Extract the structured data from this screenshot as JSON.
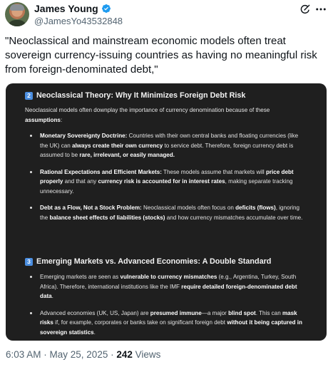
{
  "author": {
    "display_name": "James Young",
    "handle": "@JamesYo43532848"
  },
  "tweet_text": "\"Neoclassical and mainstream economic models often treat sovereign currency-issuing countries as having no meaningful risk from foreign-denominated debt,\"",
  "card": {
    "section1": {
      "number": "2",
      "title": "Neoclassical Theory: Why It Minimizes Foreign Debt Risk",
      "lead_a": "Neoclassical models often downplay the importance of currency denomination because of these ",
      "lead_b": "assumptions",
      "lead_c": ":",
      "items": [
        {
          "bold_1": "Monetary Sovereignty Doctrine:",
          "text_1": " Countries with their own central banks and floating currencies (like the UK) can ",
          "bold_2": "always create their own currency",
          "text_2": " to service debt. Therefore, foreign currency debt is assumed to be ",
          "bold_3": "rare, irrelevant, or easily managed.",
          "text_3": ""
        },
        {
          "bold_1": "Rational Expectations and Efficient Markets:",
          "text_1": " These models assume that markets will ",
          "bold_2": "price debt properly",
          "text_2": " and that any ",
          "bold_3": "currency risk is accounted for in interest rates",
          "text_3": ", making separate tracking unnecessary."
        },
        {
          "bold_1": "Debt as a Flow, Not a Stock Problem:",
          "text_1": " Neoclassical models often focus on ",
          "bold_2": "deficits (flows)",
          "text_2": ", ignoring the ",
          "bold_3": "balance sheet effects of liabilities (stocks)",
          "text_3": " and how currency mismatches accumulate over time."
        }
      ]
    },
    "section2": {
      "number": "3",
      "title": "Emerging Markets vs. Advanced Economies: A Double Standard",
      "items": [
        {
          "text_1": "Emerging markets are seen as ",
          "bold_1": "vulnerable to currency mismatches",
          "text_2": " (e.g., Argentina, Turkey, South Africa). Therefore, international institutions like the IMF ",
          "bold_2": "require detailed foreign-denominated debt data",
          "text_3": ".",
          "bold_3": "",
          "text_4": "",
          "bold_4": "",
          "text_5": ""
        },
        {
          "text_1": "Advanced economies (UK, US, Japan) are ",
          "bold_1": "presumed immune",
          "text_2": "—a major ",
          "bold_2": "blind spot",
          "text_3": ". This can ",
          "bold_3": "mask risks",
          "text_4": " if, for example, corporates or banks take on significant foreign debt ",
          "bold_4": "without it being captured in sovereign statistics",
          "text_5": "."
        }
      ]
    }
  },
  "meta": {
    "time": "6:03 AM",
    "sep1": " · ",
    "date": "May 25, 2025",
    "sep2": " · ",
    "views_count": "242",
    "views_label": " Views"
  },
  "colors": {
    "verified": "#1d9bf0",
    "card_bg": "#1f1f1f",
    "num_badge": "#4b8ee0",
    "secondary_text": "#536471"
  },
  "icons": [
    "verified-badge-icon",
    "grok-icon",
    "more-options-icon",
    "number-2-icon",
    "number-3-icon"
  ]
}
